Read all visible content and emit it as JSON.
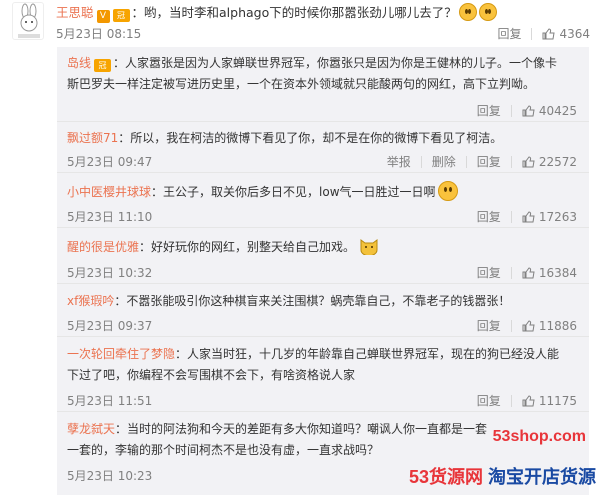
{
  "main_comment": {
    "username": "王思聪",
    "verified_badge": "V",
    "crown_badge": "冠",
    "text": "：哟，当时李和alphago下的时候你那嚣张劲儿哪儿去了？",
    "date": "5月23日 08:15",
    "reply_label": "回复",
    "likes": "4364"
  },
  "replies": [
    {
      "username": "岛线",
      "badge": "冠",
      "text": "：人家嚣张是因为人家蝉联世界冠军，你嚣张只是因为你是王健林的儿子。一个像卡斯巴罗夫一样注定被写进历史里，一个在资本外领域就只能酸两句的网红，高下立判呦。",
      "date": "",
      "report": "",
      "delete": "",
      "reply": "回复",
      "likes": "40425"
    },
    {
      "username": "飘过额71",
      "badge": "",
      "text": "：所以，我在柯洁的微博下看见了你，却不是在你的微博下看见了柯洁。",
      "date": "5月23日 09:47",
      "report": "举报",
      "delete": "删除",
      "reply": "回复",
      "likes": "22572"
    },
    {
      "username": "小中医樱井球球",
      "badge": "",
      "text": "：王公子，取关你后多日不见，low气一日胜过一日啊",
      "date": "5月23日 11:10",
      "report": "",
      "delete": "",
      "reply": "回复",
      "likes": "17263"
    },
    {
      "username": "醒的很是优雅",
      "badge": "",
      "text": "：好好玩你的网红，别整天给自己加戏。",
      "date": "5月23日 10:32",
      "report": "",
      "delete": "",
      "reply": "回复",
      "likes": "16384"
    },
    {
      "username": "xf猴瑕吟",
      "badge": "",
      "text": "：不嚣张能吸引你这种棋盲来关注围棋？蜗壳靠自己，不靠老子的钱嚣张！",
      "date": "5月23日 09:37",
      "report": "",
      "delete": "",
      "reply": "回复",
      "likes": "11886"
    },
    {
      "username": "一次轮回牵住了梦隐",
      "badge": "",
      "text": "：人家当时狂，十几岁的年龄靠自己蝉联世界冠军，现在的狗已经没人能下过了吧，你编程不会写围棋不会下，有啥资格说人家",
      "date": "5月23日 11:51",
      "report": "",
      "delete": "",
      "reply": "回复",
      "likes": "11175"
    },
    {
      "username": "孽龙弑天",
      "badge": "",
      "text": "：当时的阿法狗和今天的差距有多大你知道吗？嘲讽人你一直都是一套一套的，李输的那个时间柯杰不是也没有虚，一直求战吗？",
      "date": "5月23日 10:23",
      "report": "",
      "delete": "",
      "reply": "",
      "likes": ""
    }
  ],
  "watermark": {
    "url": "53shop.com",
    "brand_a": "53货源网",
    "brand_b": "淘宝开店货源"
  },
  "colors": {
    "username": "#eb7350",
    "meta": "#808080",
    "reply_bg": "#f2f2f5"
  }
}
